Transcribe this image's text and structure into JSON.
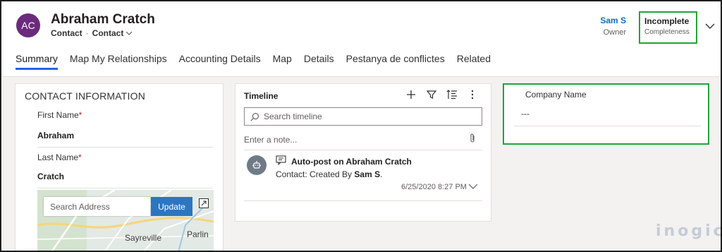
{
  "header": {
    "avatar_initials": "AC",
    "record_name": "Abraham Cratch",
    "entity_type": "Contact",
    "form_name": "Contact",
    "owner_name": "Sam S",
    "owner_label": "Owner",
    "status_value": "Incomplete",
    "status_label": "Completeness",
    "avatar_color": "#6b2a7c",
    "highlight_color": "#22a33c"
  },
  "tabs": [
    {
      "label": "Summary",
      "active": true
    },
    {
      "label": "Map My Relationships"
    },
    {
      "label": "Accounting Details"
    },
    {
      "label": "Map"
    },
    {
      "label": "Details"
    },
    {
      "label": "Pestanya de conflictes"
    },
    {
      "label": "Related"
    }
  ],
  "contact_info": {
    "title": "CONTACT INFORMATION",
    "first_name_label": "First Name",
    "first_name_value": "Abraham",
    "last_name_label": "Last Name",
    "last_name_value": "Cratch",
    "required_marker": "*",
    "map": {
      "search_placeholder": "Search Address",
      "update_label": "Update",
      "places": [
        "Sayreville",
        "Parlin"
      ]
    }
  },
  "timeline": {
    "title": "Timeline",
    "search_placeholder": "Search timeline",
    "note_placeholder": "Enter a note...",
    "post": {
      "title": "Auto-post on Abraham Cratch",
      "body_prefix": "Contact: Created By ",
      "body_user": "Sam S",
      "body_suffix": ".",
      "timestamp": "6/25/2020 8:27 PM"
    }
  },
  "company": {
    "label": "Company Name",
    "value": "---"
  },
  "watermark": "inogic"
}
